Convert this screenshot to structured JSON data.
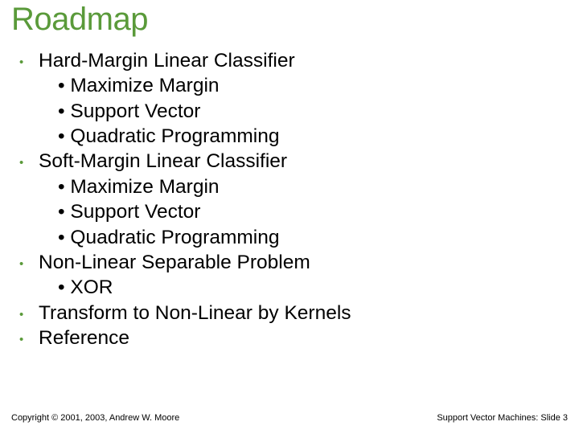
{
  "title": "Roadmap",
  "items": [
    {
      "label": "Hard-Margin Linear Classifier",
      "sub": [
        "Maximize Margin",
        "Support Vector",
        "Quadratic Programming"
      ]
    },
    {
      "label": "Soft-Margin Linear Classifier",
      "sub": [
        "Maximize Margin",
        "Support Vector",
        "Quadratic Programming"
      ]
    },
    {
      "label": "Non-Linear Separable Problem",
      "sub": [
        "XOR"
      ]
    },
    {
      "label": "Transform to Non-Linear by Kernels",
      "sub": []
    },
    {
      "label": "Reference",
      "sub": []
    }
  ],
  "footer": {
    "left": "Copyright © 2001, 2003, Andrew W. Moore",
    "right_prefix": "Support Vector Machines: Slide ",
    "right_num": "3"
  }
}
